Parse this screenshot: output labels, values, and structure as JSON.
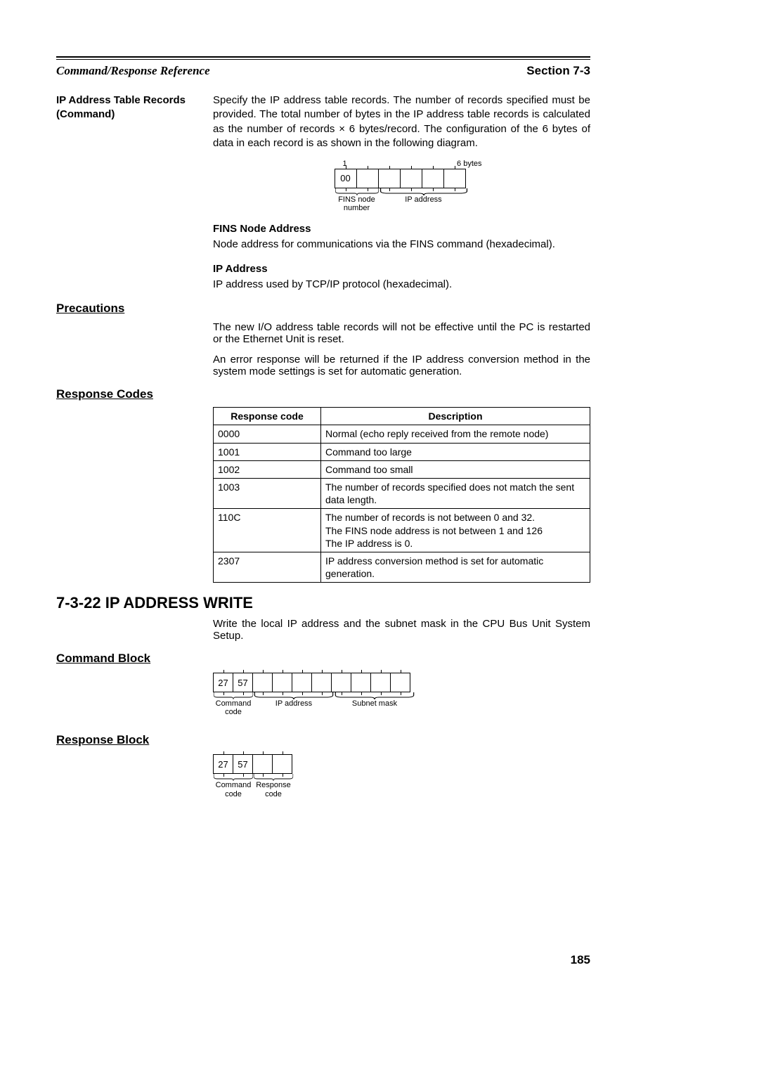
{
  "header": {
    "left": "Command/Response Reference",
    "right": "Section 7-3"
  },
  "ipTableRecords": {
    "label": "IP Address Table Records (Command)",
    "body": "Specify the IP address table records. The number of records specified must be provided. The total number of bytes in the IP address table records is calculated as the number of records × 6 bytes/record. The configuration of the 6 bytes of data in each record is as shown in the following diagram."
  },
  "diagram1": {
    "topLeft": "1",
    "topRight": "6 bytes",
    "cell0": "00",
    "br1": "FINS node number",
    "br2": "IP address"
  },
  "finsNode": {
    "title": "FINS Node Address",
    "body": "Node address for communications via the FINS command (hexadecimal)."
  },
  "ipAddr": {
    "title": "IP Address",
    "body": "IP address used by TCP/IP protocol (hexadecimal)."
  },
  "precautions": {
    "title": "Precautions",
    "p1": "The new I/O address table records will not be effective until the PC is restarted or the Ethernet Unit is reset.",
    "p2": "An error response will be returned if the IP address conversion method in the system mode settings is set for automatic generation."
  },
  "responseCodes": {
    "title": "Response Codes",
    "th1": "Response code",
    "th2": "Description",
    "rows": [
      {
        "c": "0000",
        "d": "Normal (echo reply received from the remote node)"
      },
      {
        "c": "1001",
        "d": "Command too large"
      },
      {
        "c": "1002",
        "d": "Command too small"
      },
      {
        "c": "1003",
        "d": "The number of records specified does not match the sent data length."
      },
      {
        "c": "110C",
        "d": "The number of records is not between 0 and 32.\nThe FINS node address is not between 1 and 126\nThe IP address is 0."
      },
      {
        "c": "2307",
        "d": "IP address conversion method is set for automatic generation."
      }
    ]
  },
  "ipWrite": {
    "title": "7-3-22  IP ADDRESS WRITE",
    "body": "Write the local IP address and the subnet mask in the CPU Bus Unit System Setup."
  },
  "commandBlock": {
    "title": "Command Block",
    "c0": "27",
    "c1": "57",
    "br1": "Command code",
    "br2": "IP address",
    "br3": "Subnet mask"
  },
  "responseBlock": {
    "title": "Response Block",
    "c0": "27",
    "c1": "57",
    "br1": "Command code",
    "br2": "Response code"
  },
  "pageNum": "185"
}
